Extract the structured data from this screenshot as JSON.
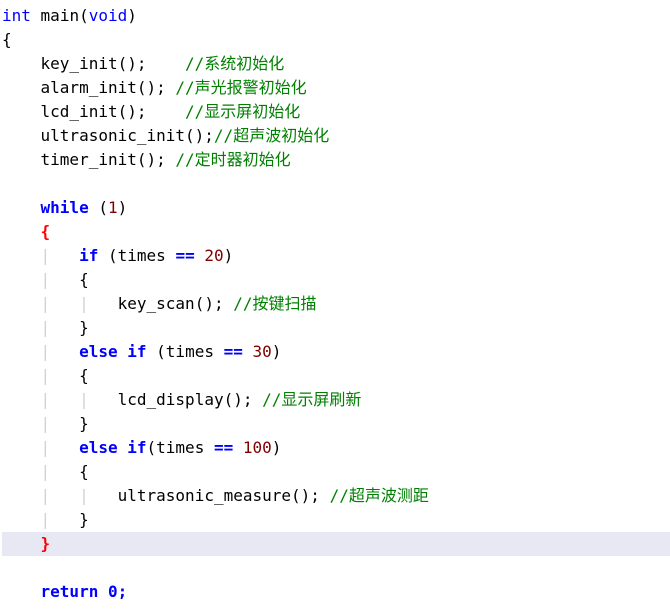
{
  "code": {
    "sig": {
      "ret": "int",
      "name": "main",
      "arg": "void"
    },
    "inits": [
      {
        "call": "key_init();",
        "pad": "    ",
        "comment": "//系统初始化"
      },
      {
        "call": "alarm_init();",
        "pad": " ",
        "comment": "//声光报警初始化"
      },
      {
        "call": "lcd_init();",
        "pad": "    ",
        "comment": "//显示屏初始化"
      },
      {
        "call": "ultrasonic_init();",
        "pad": "",
        "comment": "//超声波初始化"
      },
      {
        "call": "timer_init();",
        "pad": " ",
        "comment": "//定时器初始化"
      }
    ],
    "while_kw": "while",
    "while_cond_open": " (",
    "while_cond_val": "1",
    "while_cond_close": ")",
    "if_kw": "if",
    "else_kw": "else",
    "eq": "==",
    "var": "times",
    "branches": [
      {
        "val": "20",
        "call": "key_scan();",
        "comment": "//按键扫描"
      },
      {
        "val": "30",
        "call": "lcd_display();",
        "comment": "//显示屏刷新"
      },
      {
        "val": "100",
        "call": "ultrasonic_measure();",
        "comment": "//超声波测距"
      }
    ],
    "return_stmt": "return 0;",
    "brace_open": "{",
    "brace_close": "}"
  }
}
